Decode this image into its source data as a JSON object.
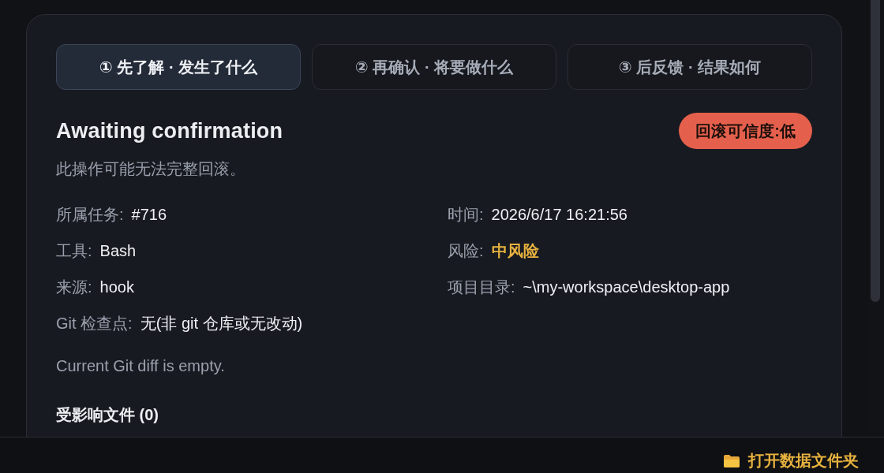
{
  "tabs": [
    {
      "label": "① 先了解 · 发生了什么",
      "selected": true
    },
    {
      "label": "② 再确认 · 将要做什么",
      "selected": false
    },
    {
      "label": "③ 后反馈 · 结果如何",
      "selected": false
    }
  ],
  "header": {
    "title": "Awaiting confirmation",
    "badge": "回滚可信度:低",
    "subtitle": "此操作可能无法完整回滚。"
  },
  "fields": [
    {
      "label": "所属任务:",
      "value": "#716",
      "kind": "plain"
    },
    {
      "label": "时间:",
      "value": "2026/6/17 16:21:56",
      "kind": "plain"
    },
    {
      "label": "工具:",
      "value": "Bash",
      "kind": "plain"
    },
    {
      "label": "风险:",
      "value": "中风险",
      "kind": "risk"
    },
    {
      "label": "来源:",
      "value": "hook",
      "kind": "plain"
    },
    {
      "label": "项目目录:",
      "value": "~\\my-workspace\\desktop-app",
      "kind": "plain"
    },
    {
      "label": "Git 检查点:",
      "value": "无(非 git 仓库或无改动)",
      "kind": "plain"
    }
  ],
  "diff_note": "Current Git diff is empty.",
  "affected_files": {
    "title": "受影响文件 (0)"
  },
  "footer": {
    "button": "打开数据文件夹"
  }
}
